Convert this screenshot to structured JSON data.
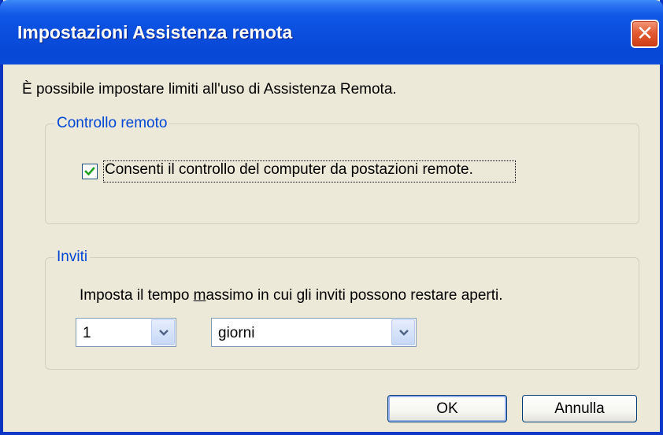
{
  "window": {
    "title": "Impostazioni Assistenza remota",
    "close_symbol": "✕"
  },
  "intro_text": "È possibile impostare limiti all'uso di Assistenza Remota.",
  "remote_control": {
    "group_label": "Controllo remoto",
    "checkbox_label": "Consenti il controllo del computer da postazioni remote.",
    "checked": true
  },
  "invitations": {
    "group_label": "Inviti",
    "description": "Imposta il tempo massimo in cui gli inviti possono restare aperti.",
    "duration_value": "1",
    "unit_value": "giorni"
  },
  "buttons": {
    "ok_label": "OK",
    "cancel_label": "Annulla"
  },
  "icons": {
    "close": "close-icon",
    "check": "checkmark-icon",
    "dropdown": "chevron-down-icon"
  },
  "colors": {
    "title_bar": "#0a4bd9",
    "group_label": "#0046d5",
    "dialog_bg": "#ece9d8",
    "close_button": "#e25b32",
    "check": "#21a121"
  }
}
